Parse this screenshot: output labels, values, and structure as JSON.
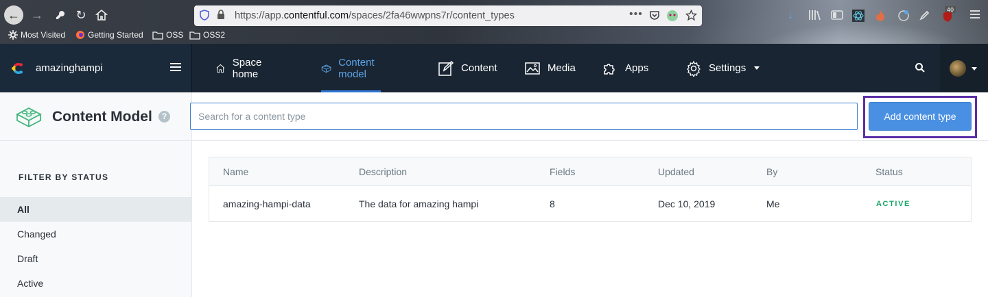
{
  "browser": {
    "url_prefix": "https://app.",
    "url_domain": "contentful.com",
    "url_path": "/spaces/2fa46wwpns7r/content_types",
    "badge_count": "40",
    "bookmarks": [
      {
        "label": "Most Visited",
        "icon": "gear-icon"
      },
      {
        "label": "Getting Started",
        "icon": "firefox-icon"
      },
      {
        "label": "OSS",
        "icon": "folder-icon"
      },
      {
        "label": "OSS2",
        "icon": "folder-icon"
      }
    ]
  },
  "app": {
    "space_name": "amazinghampi",
    "nav": [
      {
        "label": "Space home",
        "icon": "home-icon"
      },
      {
        "label": "Content model",
        "icon": "content-model-icon",
        "active": true
      },
      {
        "label": "Content",
        "icon": "pen-icon"
      },
      {
        "label": "Media",
        "icon": "image-icon"
      },
      {
        "label": "Apps",
        "icon": "puzzle-icon"
      },
      {
        "label": "Settings",
        "icon": "gear-icon"
      }
    ]
  },
  "page": {
    "title": "Content Model",
    "help": "?",
    "search_placeholder": "Search for a content type",
    "add_button": "Add content type"
  },
  "sidebar": {
    "title": "FILTER BY STATUS",
    "items": [
      {
        "label": "All",
        "active": true
      },
      {
        "label": "Changed"
      },
      {
        "label": "Draft"
      },
      {
        "label": "Active"
      }
    ]
  },
  "table": {
    "headers": [
      "Name",
      "Description",
      "Fields",
      "Updated",
      "By",
      "Status"
    ],
    "rows": [
      {
        "name": "amazing-hampi-data",
        "description": "The data for amazing hampi",
        "fields": "8",
        "updated": "Dec 10, 2019",
        "by": "Me",
        "status": "ACTIVE"
      }
    ]
  },
  "colors": {
    "nav_bg": "#192532",
    "accent": "#4a90e2",
    "active_status": "#14a566",
    "highlight": "#5b2ea6"
  }
}
